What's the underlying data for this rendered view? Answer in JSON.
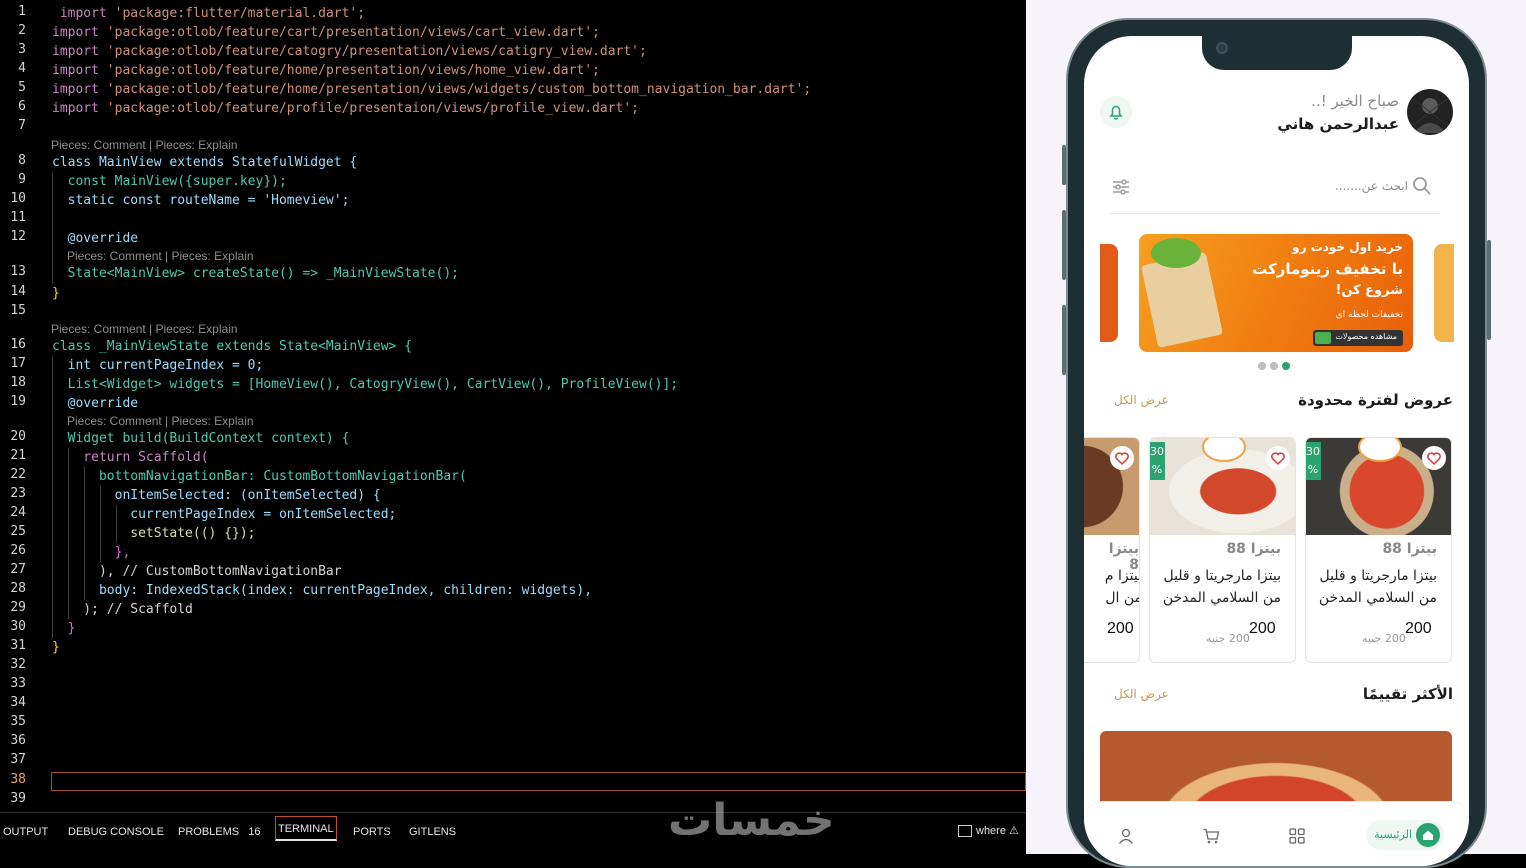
{
  "editor": {
    "line_numbers": [
      "1",
      "2",
      "3",
      "4",
      "5",
      "6",
      "7",
      "8",
      "9",
      "10",
      "11",
      "12",
      "13",
      "14",
      "15",
      "16",
      "17",
      "18",
      "19",
      "20",
      "21",
      "22",
      "23",
      "24",
      "25",
      "26",
      "27",
      "28",
      "29",
      "30",
      "31",
      "32",
      "33",
      "34",
      "35",
      "36",
      "37",
      "38",
      "39"
    ],
    "codelens": "Pieces: Comment | Pieces: Explain",
    "lines": {
      "l1": "import 'package:flutter/material.dart';",
      "l2": "import 'package:otlob/feature/cart/presentation/views/cart_view.dart';",
      "l3": "import 'package:otlob/feature/catogry/presentation/views/catigry_view.dart';",
      "l4": "import 'package:otlob/feature/home/presentation/views/home_view.dart';",
      "l5": "import 'package:otlob/feature/home/presentation/views/widgets/custom_bottom_navigation_bar.dart';",
      "l6": "import 'package:otlob/feature/profile/presentaion/views/profile_view.dart';",
      "l8": "class MainView extends StatefulWidget {",
      "l9": "  const MainView({super.key});",
      "l10": "  static const routeName = 'Homeview';",
      "l12": "  @override",
      "l13": "  State<MainView> createState() => _MainViewState();",
      "l14": "}",
      "l16": "class _MainViewState extends State<MainView> {",
      "l17": "  int currentPageIndex = 0;",
      "l18": "  List<Widget> widgets = [HomeView(), CatogryView(), CartView(), ProfileView()];",
      "l19": "  @override",
      "l20": "  Widget build(BuildContext context) {",
      "l21": "    return Scaffold(",
      "l22": "      bottomNavigationBar: CustomBottomNavigationBar(",
      "l23": "        onItemSelected: (onItemSelected) {",
      "l24": "          currentPageIndex = onItemSelected;",
      "l25": "          setState(() {});",
      "l26": "        },",
      "l27": "      ), // CustomBottomNavigationBar",
      "l28": "      body: IndexedStack(index: currentPageIndex, children: widgets),",
      "l29": "    ); // Scaffold",
      "l30": "  }",
      "l31": "}"
    }
  },
  "panel": {
    "tabs": [
      "OUTPUT",
      "DEBUG CONSOLE",
      "PROBLEMS",
      "TERMINAL",
      "PORTS",
      "GITLENS"
    ],
    "problems_count": "16",
    "active_tab": "TERMINAL",
    "where_label": "where"
  },
  "watermark": "خمسات",
  "app": {
    "greeting": "صباح الخير !..",
    "user_name": "عبدالرحمن هاني",
    "search_placeholder": "ابحث عن.......",
    "banner": {
      "line1": "خرید اول خودت رو",
      "line2": "با تخفیف زینومارکت",
      "line3": "شروع کن!",
      "line4": "تخفیفات لحظه ای",
      "button": "مشاهده محصولات"
    },
    "section1_title": "عروض لفترة محدودة",
    "section1_link": "عرض الكل",
    "products": [
      {
        "badge": "30 %",
        "name": "بيتزا 88",
        "desc": "بيتزا مارجريتا و قليل من السلامي المدخن",
        "price": "200",
        "old_price": "200 جنيه"
      },
      {
        "badge": "30 %",
        "name": "بيتزا 88",
        "desc": "بيتزا مارجريتا و قليل من السلامي المدخن",
        "price": "200",
        "old_price": "200 جنيه"
      },
      {
        "badge": "",
        "name": "بيتزا 8",
        "desc": "بيتزا م من ال",
        "price": "200",
        "old_price": ""
      }
    ],
    "section2_title": "الأكثر تقييمًا",
    "section2_link": "عرض الكل",
    "nav": {
      "home_label": "الرئيسية"
    },
    "colors": {
      "accent": "#2aa371",
      "banner": "#f07a10",
      "link": "#c49a55"
    }
  }
}
